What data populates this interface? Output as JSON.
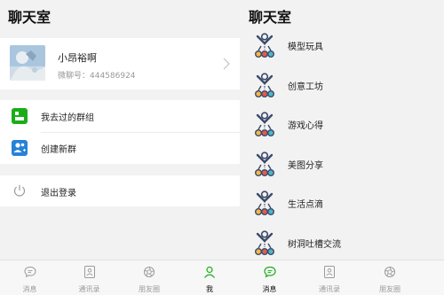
{
  "left": {
    "title": "聊天室",
    "profile": {
      "name": "小昂裕啊",
      "wechat_id": "微聊号：444586924"
    },
    "menu": [
      {
        "label": "我去过的群组",
        "color": "#1aad19",
        "icon": "groups-icon"
      },
      {
        "label": "创建新群",
        "color": "#2782d7",
        "icon": "create-group-icon"
      }
    ],
    "logout_label": "退出登录",
    "tabs": [
      {
        "label": "消息",
        "icon": "chat-bubble-icon"
      },
      {
        "label": "通讯录",
        "icon": "contacts-icon"
      },
      {
        "label": "朋友圈",
        "icon": "aperture-icon"
      },
      {
        "label": "我",
        "icon": "person-icon"
      }
    ],
    "active_tab": "我"
  },
  "right": {
    "title": "聊天室",
    "groups": [
      {
        "label": "模型玩具"
      },
      {
        "label": "创意工坊"
      },
      {
        "label": "游戏心得"
      },
      {
        "label": "美图分享"
      },
      {
        "label": "生活点滴"
      },
      {
        "label": "树洞吐槽交流"
      }
    ],
    "tabs": [
      {
        "label": "消息",
        "icon": "chat-bubble-icon"
      },
      {
        "label": "通讯录",
        "icon": "contacts-icon"
      },
      {
        "label": "朋友圈",
        "icon": "aperture-icon"
      }
    ],
    "active_tab": "消息"
  },
  "colors": {
    "accent_green": "#1aad19",
    "accent_blue": "#2782d7",
    "background": "#f2f2f2"
  }
}
